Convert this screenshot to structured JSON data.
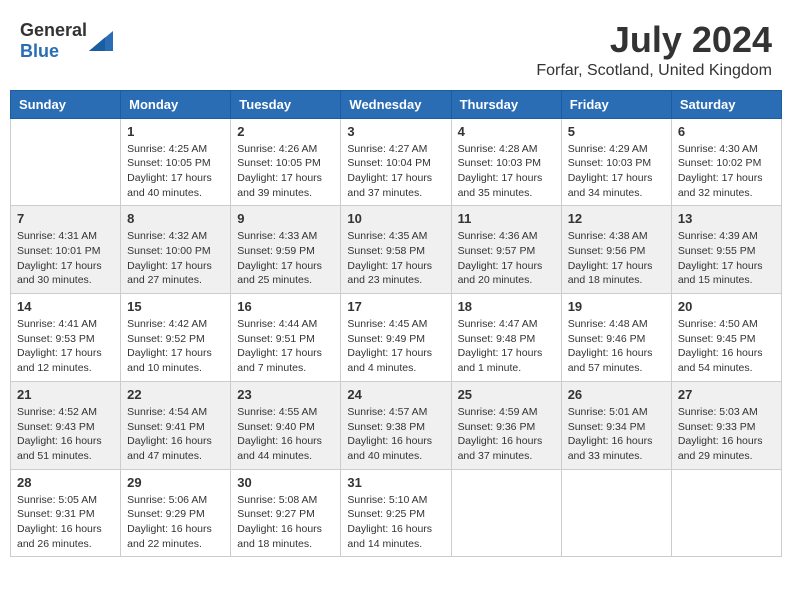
{
  "header": {
    "logo_general": "General",
    "logo_blue": "Blue",
    "month_year": "July 2024",
    "location": "Forfar, Scotland, United Kingdom"
  },
  "days_of_week": [
    "Sunday",
    "Monday",
    "Tuesday",
    "Wednesday",
    "Thursday",
    "Friday",
    "Saturday"
  ],
  "weeks": [
    {
      "days": [
        {
          "number": "",
          "info": ""
        },
        {
          "number": "1",
          "info": "Sunrise: 4:25 AM\nSunset: 10:05 PM\nDaylight: 17 hours\nand 40 minutes."
        },
        {
          "number": "2",
          "info": "Sunrise: 4:26 AM\nSunset: 10:05 PM\nDaylight: 17 hours\nand 39 minutes."
        },
        {
          "number": "3",
          "info": "Sunrise: 4:27 AM\nSunset: 10:04 PM\nDaylight: 17 hours\nand 37 minutes."
        },
        {
          "number": "4",
          "info": "Sunrise: 4:28 AM\nSunset: 10:03 PM\nDaylight: 17 hours\nand 35 minutes."
        },
        {
          "number": "5",
          "info": "Sunrise: 4:29 AM\nSunset: 10:03 PM\nDaylight: 17 hours\nand 34 minutes."
        },
        {
          "number": "6",
          "info": "Sunrise: 4:30 AM\nSunset: 10:02 PM\nDaylight: 17 hours\nand 32 minutes."
        }
      ]
    },
    {
      "days": [
        {
          "number": "7",
          "info": "Sunrise: 4:31 AM\nSunset: 10:01 PM\nDaylight: 17 hours\nand 30 minutes."
        },
        {
          "number": "8",
          "info": "Sunrise: 4:32 AM\nSunset: 10:00 PM\nDaylight: 17 hours\nand 27 minutes."
        },
        {
          "number": "9",
          "info": "Sunrise: 4:33 AM\nSunset: 9:59 PM\nDaylight: 17 hours\nand 25 minutes."
        },
        {
          "number": "10",
          "info": "Sunrise: 4:35 AM\nSunset: 9:58 PM\nDaylight: 17 hours\nand 23 minutes."
        },
        {
          "number": "11",
          "info": "Sunrise: 4:36 AM\nSunset: 9:57 PM\nDaylight: 17 hours\nand 20 minutes."
        },
        {
          "number": "12",
          "info": "Sunrise: 4:38 AM\nSunset: 9:56 PM\nDaylight: 17 hours\nand 18 minutes."
        },
        {
          "number": "13",
          "info": "Sunrise: 4:39 AM\nSunset: 9:55 PM\nDaylight: 17 hours\nand 15 minutes."
        }
      ]
    },
    {
      "days": [
        {
          "number": "14",
          "info": "Sunrise: 4:41 AM\nSunset: 9:53 PM\nDaylight: 17 hours\nand 12 minutes."
        },
        {
          "number": "15",
          "info": "Sunrise: 4:42 AM\nSunset: 9:52 PM\nDaylight: 17 hours\nand 10 minutes."
        },
        {
          "number": "16",
          "info": "Sunrise: 4:44 AM\nSunset: 9:51 PM\nDaylight: 17 hours\nand 7 minutes."
        },
        {
          "number": "17",
          "info": "Sunrise: 4:45 AM\nSunset: 9:49 PM\nDaylight: 17 hours\nand 4 minutes."
        },
        {
          "number": "18",
          "info": "Sunrise: 4:47 AM\nSunset: 9:48 PM\nDaylight: 17 hours\nand 1 minute."
        },
        {
          "number": "19",
          "info": "Sunrise: 4:48 AM\nSunset: 9:46 PM\nDaylight: 16 hours\nand 57 minutes."
        },
        {
          "number": "20",
          "info": "Sunrise: 4:50 AM\nSunset: 9:45 PM\nDaylight: 16 hours\nand 54 minutes."
        }
      ]
    },
    {
      "days": [
        {
          "number": "21",
          "info": "Sunrise: 4:52 AM\nSunset: 9:43 PM\nDaylight: 16 hours\nand 51 minutes."
        },
        {
          "number": "22",
          "info": "Sunrise: 4:54 AM\nSunset: 9:41 PM\nDaylight: 16 hours\nand 47 minutes."
        },
        {
          "number": "23",
          "info": "Sunrise: 4:55 AM\nSunset: 9:40 PM\nDaylight: 16 hours\nand 44 minutes."
        },
        {
          "number": "24",
          "info": "Sunrise: 4:57 AM\nSunset: 9:38 PM\nDaylight: 16 hours\nand 40 minutes."
        },
        {
          "number": "25",
          "info": "Sunrise: 4:59 AM\nSunset: 9:36 PM\nDaylight: 16 hours\nand 37 minutes."
        },
        {
          "number": "26",
          "info": "Sunrise: 5:01 AM\nSunset: 9:34 PM\nDaylight: 16 hours\nand 33 minutes."
        },
        {
          "number": "27",
          "info": "Sunrise: 5:03 AM\nSunset: 9:33 PM\nDaylight: 16 hours\nand 29 minutes."
        }
      ]
    },
    {
      "days": [
        {
          "number": "28",
          "info": "Sunrise: 5:05 AM\nSunset: 9:31 PM\nDaylight: 16 hours\nand 26 minutes."
        },
        {
          "number": "29",
          "info": "Sunrise: 5:06 AM\nSunset: 9:29 PM\nDaylight: 16 hours\nand 22 minutes."
        },
        {
          "number": "30",
          "info": "Sunrise: 5:08 AM\nSunset: 9:27 PM\nDaylight: 16 hours\nand 18 minutes."
        },
        {
          "number": "31",
          "info": "Sunrise: 5:10 AM\nSunset: 9:25 PM\nDaylight: 16 hours\nand 14 minutes."
        },
        {
          "number": "",
          "info": ""
        },
        {
          "number": "",
          "info": ""
        },
        {
          "number": "",
          "info": ""
        }
      ]
    }
  ]
}
